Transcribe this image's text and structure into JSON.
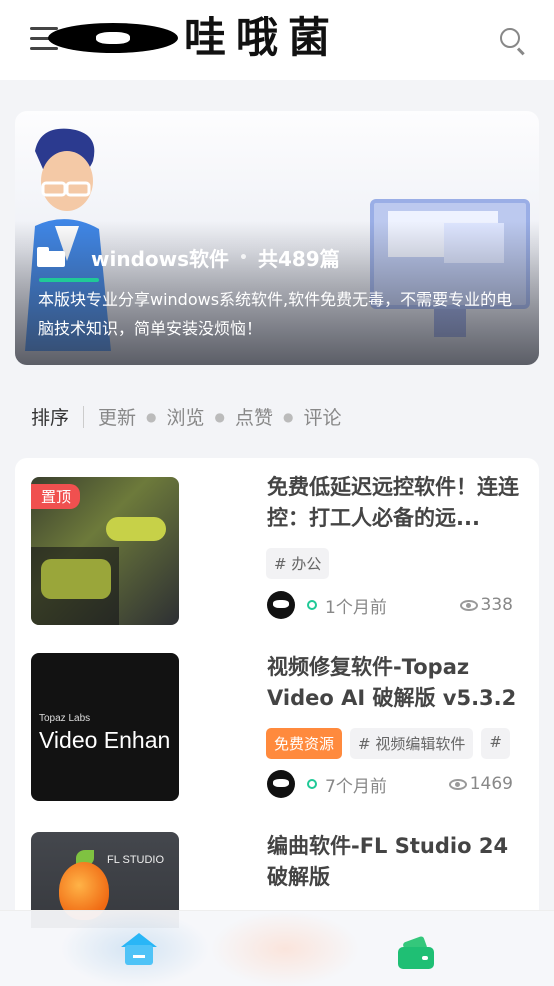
{
  "header": {
    "logo_text": "哇哦菌",
    "menu_icon": "hamburger-menu-icon",
    "search_icon": "search-icon"
  },
  "banner": {
    "category_name": "windows软件",
    "separator": "•",
    "post_count": "共489篇",
    "description": "本版块专业分享windows系统软件,软件免费无毒，不需要专业的电脑技术知识，简单安装没烦恼！"
  },
  "sort": {
    "label": "排序",
    "options": [
      "更新",
      "浏览",
      "点赞",
      "评论"
    ]
  },
  "posts": [
    {
      "title": "免费低延迟远控软件！连连控：打工人必备的远...",
      "badge": "置顶",
      "tags": [
        "# 办公"
      ],
      "time": "1个月前",
      "views": "338"
    },
    {
      "title": "视频修复软件-Topaz Video AI 破解版 v5.3.2",
      "thumb_small": "Topaz Labs",
      "thumb_big": "Video Enhan",
      "tags": [
        "免费资源",
        "# 视频编辑软件",
        "#"
      ],
      "time": "7个月前",
      "views": "1469"
    },
    {
      "title": "编曲软件-FL Studio 24破解版",
      "thumb_small": "FL STUDIO"
    }
  ],
  "colors": {
    "accent_green": "#20c997",
    "pin_red": "#f0504f",
    "free_orange": "#ff8a3d",
    "home_blue": "#4fc3f7",
    "wallet_green": "#1fbf74"
  },
  "bottom_nav": {
    "home_icon": "home-icon",
    "wallet_icon": "wallet-icon"
  }
}
